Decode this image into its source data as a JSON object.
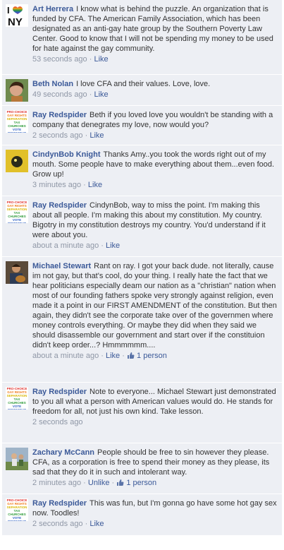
{
  "comments": [
    {
      "author": "Art Herrera",
      "text": "I know what is behind the puzzle. An organization that is funded by CFA. The American Family Association, which has been designated as an anti-gay hate group by the Southern Poverty Law Center. Good to know that I will not be spending my money to be used for hate against the gay community.",
      "time": "53 seconds ago",
      "action": "Like",
      "avatar": "i-heart-ny-avatar"
    },
    {
      "author": "Beth Nolan",
      "text": "I love CFA and their values. Love, love.",
      "time": "49 seconds ago",
      "action": "Like",
      "avatar": "photo-avatar"
    },
    {
      "author": "Ray Redspider",
      "text": "Beth if you loved love you wouldn't be standing with a company that denegrates my love, now would you?",
      "time": "2 seconds ago",
      "action": "Like",
      "avatar": "pro-choice-text-avatar"
    },
    {
      "author": "CindynBob Knight",
      "text": "Thanks Amy..you took the words right out of my mouth. Some people have to make everything about them...even food. Grow up!",
      "time": "3 minutes ago",
      "action": "Like",
      "avatar": "yellow-photo-avatar"
    },
    {
      "author": "Ray Redspider",
      "text": "CindynBob, way to miss the point. I'm making this about all people. I'm making this about my constitution. My country. Bigotry in my constitution destroys my country. You'd understand if it were about you.",
      "time": "about a minute ago",
      "action": "Like",
      "avatar": "pro-choice-text-avatar"
    },
    {
      "author": "Michael Stewart",
      "text": "Rant on ray. I got your back dude. not literally, cause im not gay, but that's cool, do your thing. I really hate the fact that we hear politicians especially deam our nation as a \"christian\" nation when most of our founding fathers spoke very strongly against religion, even made it a point in our FIRST AMENDMENT of the constitution. But then again, they didn't see the corporate take over of the governmen where money controls everything. Or maybe they did when they said we should disassemble our government and start over if the constituion didn't keep order...? Hmmmmmm....",
      "time": "about a minute ago",
      "action": "Like",
      "likes": "1 person",
      "avatar": "guitar-photo-avatar"
    },
    {
      "author": "Ray Redspider",
      "text": "Note to everyone... Michael Stewart just demonstrated to you all what a person with American values would do. He stands for freedom for all, not just his own kind. Take lesson.",
      "time": "2 seconds ago",
      "action": "",
      "avatar": "pro-choice-text-avatar"
    },
    {
      "author": "Zachary McCann",
      "text": "People should be free to sin however they please. CFA, as a corporation is free to spend their money as they please, its sad that they do it in such and intolerant way.",
      "time": "2 minutes ago",
      "action": "Unlike",
      "likes": "1 person",
      "avatar": "outdoor-photo-avatar"
    },
    {
      "author": "Ray Redspider",
      "text": "This was fun, but I'm gonna go have some hot gay sex now. Toodles!",
      "time": "2 seconds ago",
      "action": "Like",
      "avatar": "pro-choice-text-avatar"
    }
  ],
  "colors": {
    "background": "#edeff4",
    "link": "#3b5998",
    "meta": "#8f97a6"
  }
}
